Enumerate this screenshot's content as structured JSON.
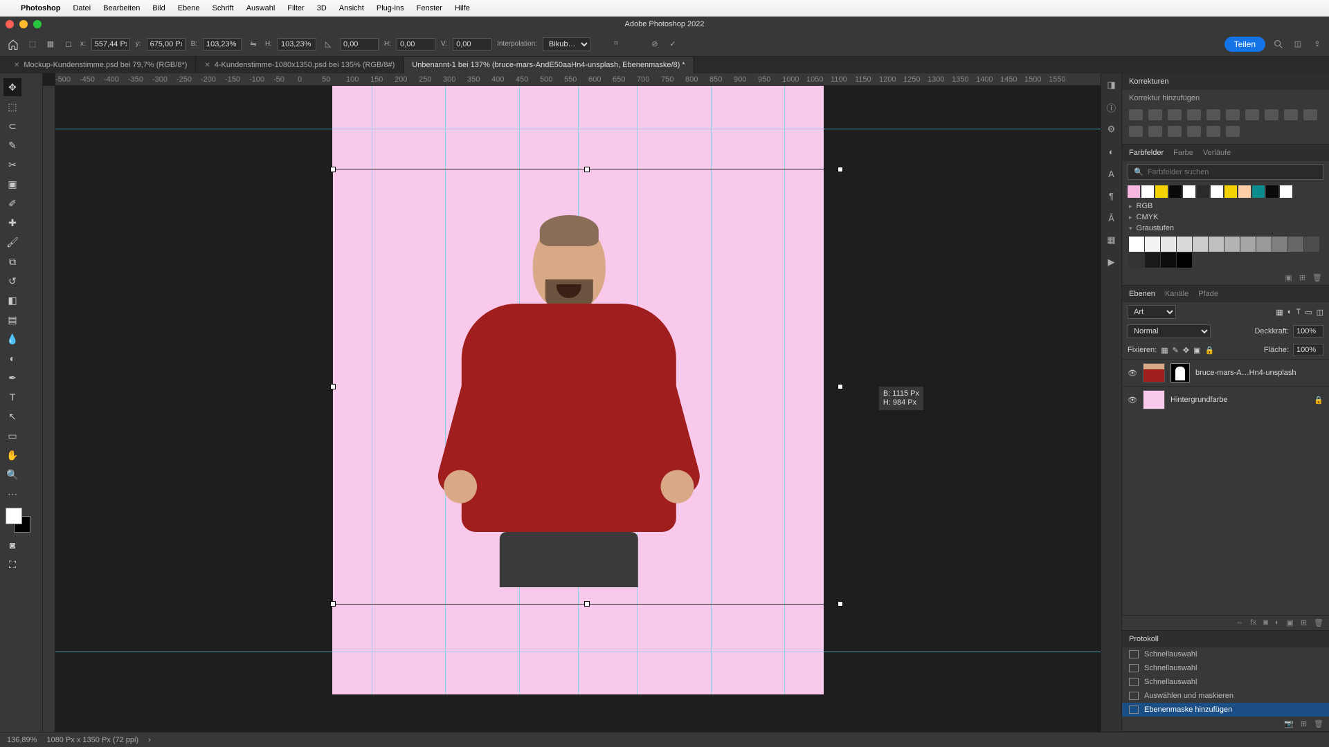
{
  "menubar": {
    "app": "Photoshop",
    "items": [
      "Datei",
      "Bearbeiten",
      "Bild",
      "Ebene",
      "Schrift",
      "Auswahl",
      "Filter",
      "3D",
      "Ansicht",
      "Plug-ins",
      "Fenster",
      "Hilfe"
    ]
  },
  "window_title": "Adobe Photoshop 2022",
  "options": {
    "x_label": "x:",
    "x": "557,44 Px",
    "y_label": "y:",
    "y": "675,00 Px",
    "w_label": "B:",
    "w": "103,23%",
    "h_label": "H:",
    "h": "103,23%",
    "angle_label": "",
    "angle": "0,00",
    "skh_label": "H:",
    "skh": "0,00",
    "skv_label": "V:",
    "skv": "0,00",
    "interp_label": "Interpolation:",
    "interp": "Bikub…",
    "teilen": "Teilen"
  },
  "tabs": [
    {
      "label": "Mockup-Kundenstimme.psd bei 79,7% (RGB/8*)",
      "active": false
    },
    {
      "label": "4-Kundenstimme-1080x1350.psd bei 135% (RGB/8#)",
      "active": false
    },
    {
      "label": "Unbenannt-1 bei 137% (bruce-mars-AndE50aaHn4-unsplash, Ebenenmaske/8) *",
      "active": true
    }
  ],
  "ruler_marks": [
    "-500",
    "-450",
    "-400",
    "-350",
    "-300",
    "-250",
    "-200",
    "-150",
    "-100",
    "-50",
    "0",
    "50",
    "100",
    "150",
    "200",
    "250",
    "300",
    "350",
    "400",
    "450",
    "500",
    "550",
    "600",
    "650",
    "700",
    "750",
    "800",
    "850",
    "900",
    "950",
    "1000",
    "1050",
    "1100",
    "1150",
    "1200",
    "1250",
    "1300",
    "1350",
    "1400",
    "1450",
    "1500",
    "1550"
  ],
  "transform_readout": {
    "b": "B: 1115 Px",
    "h": "H: 984 Px"
  },
  "panels": {
    "korrekturen": {
      "title": "Korrekturen",
      "sub": "Korrektur hinzufügen"
    },
    "swatches": {
      "tabs": [
        "Farbfelder",
        "Farbe",
        "Verläufe"
      ],
      "search_ph": "Farbfelder suchen",
      "groups": [
        "RGB",
        "CMYK",
        "Graustufen"
      ],
      "row_colors": [
        "#f7b7de",
        "#ffffff",
        "#f5d300",
        "#0a0a0a",
        "#ffffff",
        "#2a2a2a",
        "#ffffff",
        "#f5d300",
        "#ffcda6",
        "#0b8b8b",
        "#0a0a0a",
        "#ffffff"
      ],
      "grays": [
        "#ffffff",
        "#f2f2f2",
        "#e6e6e6",
        "#d9d9d9",
        "#cccccc",
        "#bfbfbf",
        "#b3b3b3",
        "#a6a6a6",
        "#999999",
        "#808080",
        "#666666",
        "#4d4d4d",
        "#333333",
        "#1a1a1a",
        "#0d0d0d",
        "#000000"
      ]
    },
    "layers": {
      "tabs": [
        "Ebenen",
        "Kanäle",
        "Pfade"
      ],
      "kind": "Art",
      "blend": "Normal",
      "opacity_label": "Deckkraft:",
      "opacity": "100%",
      "lock_label": "Fixieren:",
      "fill_label": "Fläche:",
      "fill": "100%",
      "items": [
        {
          "name": "bruce-mars-A…Hn4-unsplash",
          "masked": true,
          "locked": false
        },
        {
          "name": "Hintergrundfarbe",
          "masked": false,
          "locked": true
        }
      ]
    },
    "protokoll": {
      "title": "Protokoll",
      "items": [
        "Schnellauswahl",
        "Schnellauswahl",
        "Schnellauswahl",
        "Auswählen und maskieren",
        "Ebenenmaske hinzufügen"
      ]
    }
  },
  "status": {
    "zoom": "136,89%",
    "docinfo": "1080 Px x 1350 Px (72 ppi)"
  }
}
